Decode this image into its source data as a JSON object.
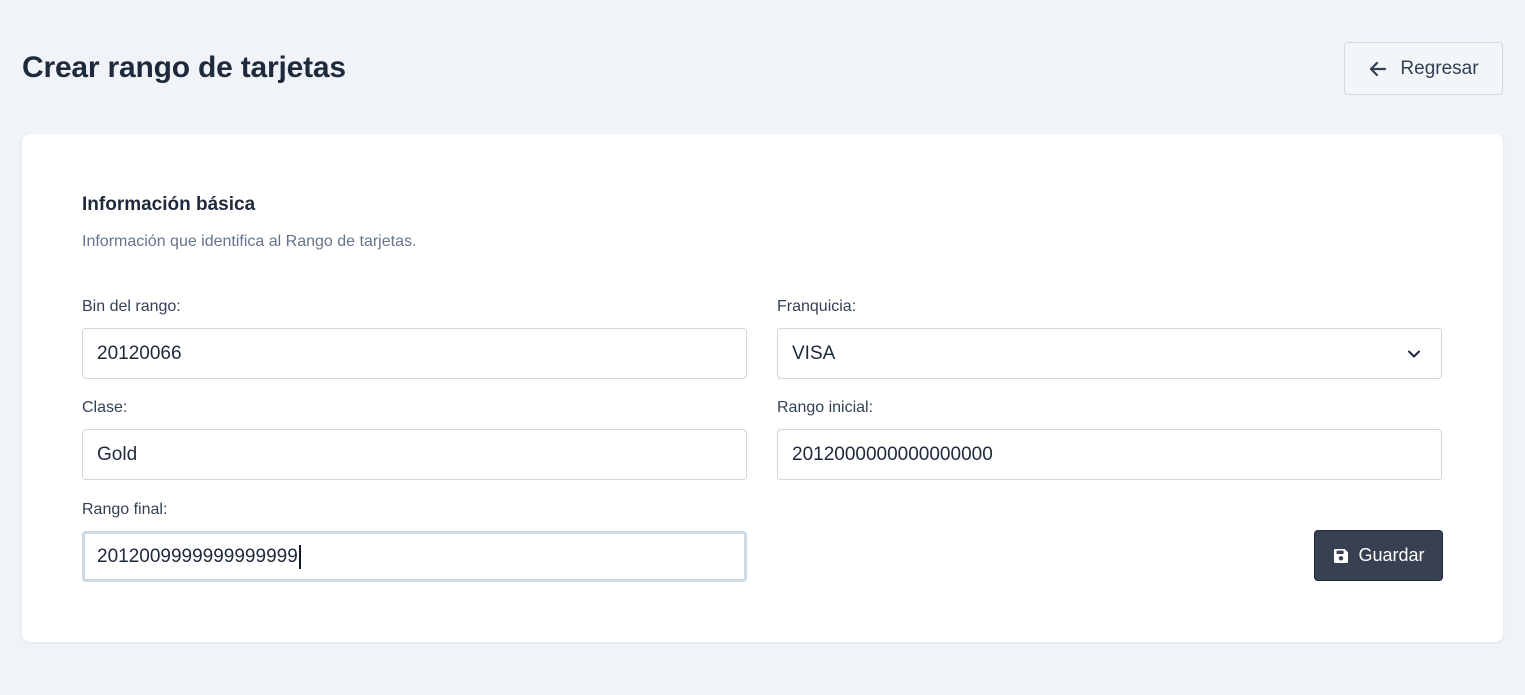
{
  "header": {
    "title": "Crear rango de tarjetas",
    "back_label": "Regresar"
  },
  "section": {
    "title": "Información básica",
    "description": "Información que identifica al Rango de tarjetas."
  },
  "form": {
    "bin": {
      "label": "Bin del rango:",
      "value": "20120066"
    },
    "franquicia": {
      "label": "Franquicia:",
      "value": "VISA"
    },
    "clase": {
      "label": "Clase:",
      "value": "Gold"
    },
    "rango_inicial": {
      "label": "Rango inicial:",
      "value": "2012000000000000000"
    },
    "rango_final": {
      "label": "Rango final:",
      "value": "2012009999999999999"
    }
  },
  "actions": {
    "save_label": "Guardar"
  },
  "icons": {
    "back": "arrow-left-icon",
    "save": "floppy-disk-icon",
    "dropdown": "chevron-down-icon"
  },
  "colors": {
    "background": "#f0f4f8",
    "card": "#ffffff",
    "primary_button": "#374151",
    "muted_text": "#64748b"
  }
}
